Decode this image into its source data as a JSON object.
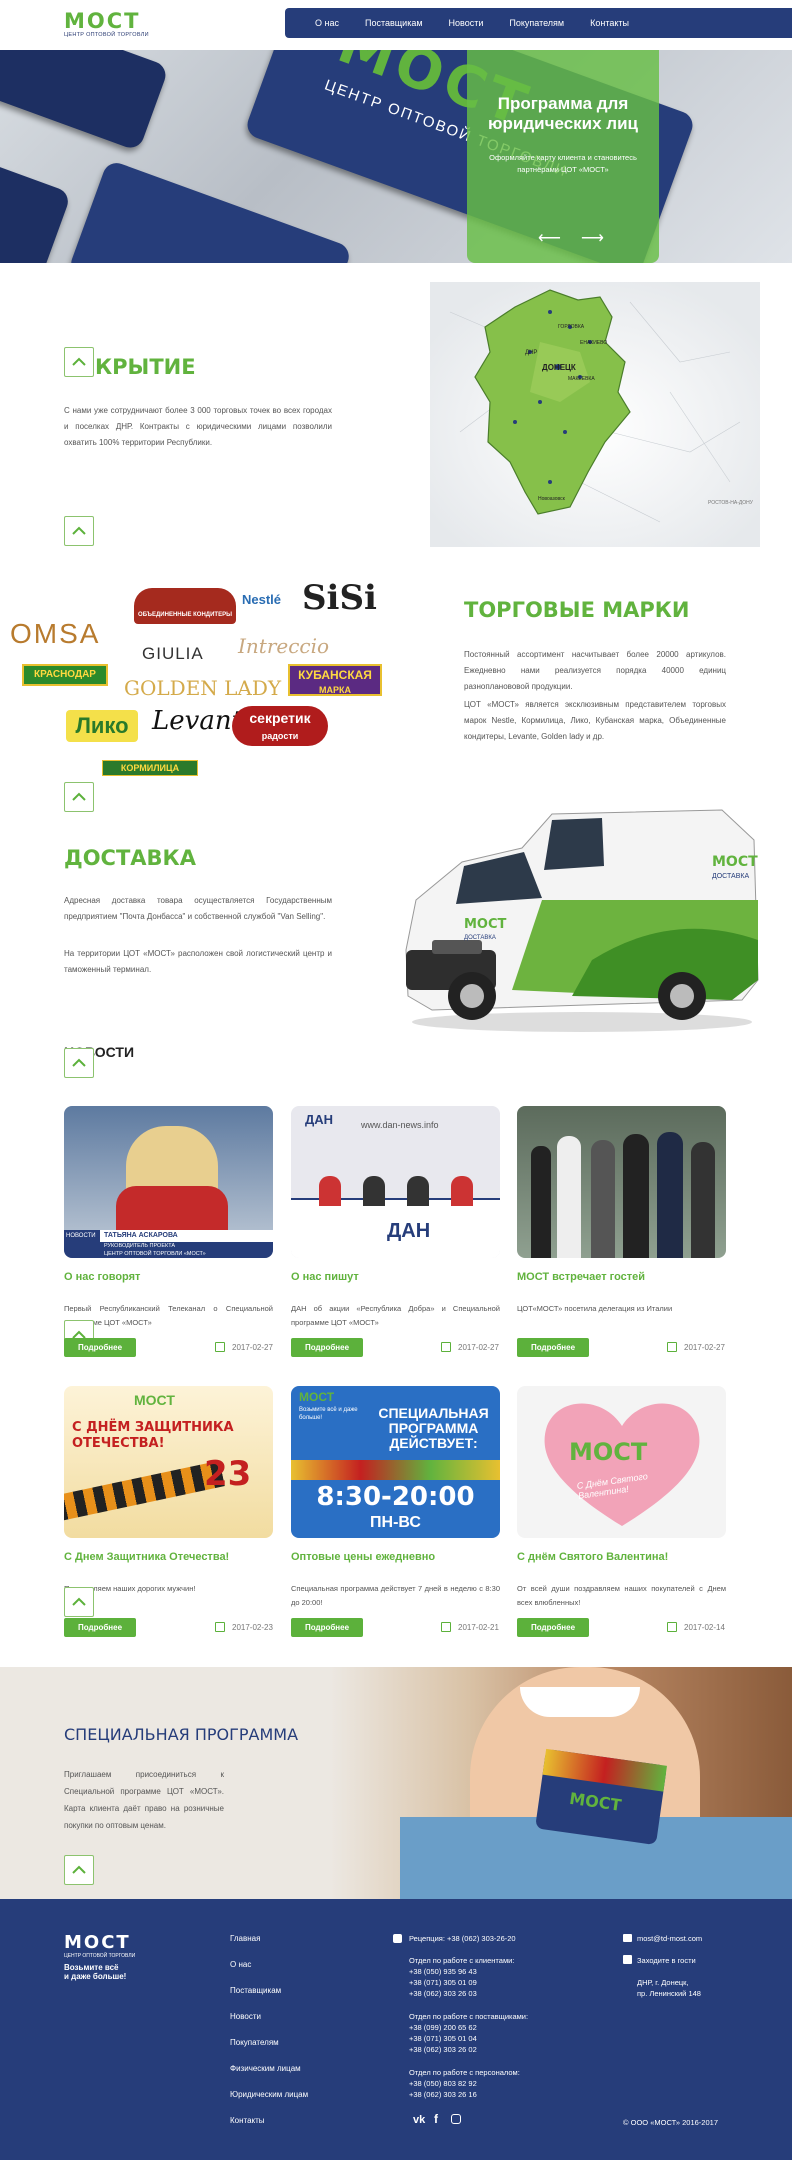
{
  "header": {
    "logo_text": "МОСТ",
    "logo_sub": "ЦЕНТР ОПТОВОЙ ТОРГОВЛИ",
    "nav": [
      "О нас",
      "Поставщикам",
      "Новости",
      "Покупателям",
      "Контакты"
    ]
  },
  "hero": {
    "card_text": "МОСТ",
    "card_sub": "ЦЕНТР ОПТОВОЙ ТОРГОВЛИ",
    "promo_title": "Программа для юридических лиц",
    "promo_text": "Оформляйте карту клиента и становитесь партнёрами ЦОТ «МОСТ»",
    "arrow_prev": "⟵",
    "arrow_next": "⟶"
  },
  "coverage": {
    "title": "КРЫТИЕ",
    "text": "С нами уже сотрудничают более 3 000 торговых точек во всех городах и поселках ДНР. Контракты с юридическими лицами позволили охватить 100% территории Республики.",
    "map_labels": [
      "ДНР",
      "ДОНЕЦК",
      "МАКЕЕВКА",
      "ГОРЛОВКА",
      "ЕНАКИЕВО",
      "Новоазовск",
      "РОСТОВ-НА-ДОНУ"
    ]
  },
  "brands": {
    "title": "ТОРГОВЫЕ МАРКИ",
    "text1": "Постоянный ассортимент насчитывает более 20000 артикулов. Ежедневно нами реализуется порядка 40000 единиц разнопланововой продукции.",
    "text2": "ЦОТ «МОСТ» является эксклюзивным представителем торговых марок Nestle, Кормилица, Лико, Кубанская марка, Объединенные кондитеры, Levante, Golden lady и др.",
    "logos": {
      "omsa": "OMSA",
      "nestle": "Nestlé",
      "sisi": "SiSi",
      "giulia": "GIULIA",
      "intrecci": "Intreccio",
      "ok": "ОБЪЕДИНЕННЫЕ КОНДИТЕРЫ",
      "krasnodar": "КРАСНОДАР",
      "goldenlady": "GOLDEN LADY",
      "kuban": "КУБАНСКАЯ",
      "kuban2": "МАРКА",
      "liko": "Лико",
      "levante": "Levante",
      "sekretik": "секретик",
      "sekretik2": "радости",
      "kormil": "КОРМИЛИЦА"
    }
  },
  "delivery": {
    "title": "ДОСТАВКА",
    "text1": "Адресная доставка товара осуществляется Государственным предприятием \"Почта Донбасса\" и собственной службой \"Van Selling\".",
    "text2": "На территории ЦОТ «МОСТ» расположен свой логистический центр и таможенный терминал.",
    "van_logo": "МОСТ",
    "van_sub": "ДОСТАВКА"
  },
  "news": {
    "title": "НОВОСТИ",
    "more": "Подробнее",
    "items": [
      {
        "title": "О нас говорят",
        "text": "Первый Республиканский Телеканал о Специальной программе ЦОТ «МОСТ»",
        "date": "2017-02-27",
        "img_caption1": "ТАТЬЯНА АСКАРОВА",
        "img_caption2": "РУКОВОДИТЕЛЬ ПРОЕКТА",
        "img_caption3": "ЦЕНТР ОПТОВОЙ ТОРГОВЛИ «МОСТ»",
        "img_tag": "НОВОСТИ"
      },
      {
        "title": "О нас пишут",
        "text": "ДАН об акции «Республика Добра» и Специальной программе ЦОТ «МОСТ»",
        "date": "2017-02-27",
        "img_caption1": "www.dan-news.info",
        "img_tag": "ДАН"
      },
      {
        "title": "МОСТ встречает гостей",
        "text": "ЦОТ«МОСТ» посетила делегация из Италии",
        "date": "2017-02-27"
      },
      {
        "title": "С Днем Защитника Отечества!",
        "text": "Поздравляем наших дорогих мужчин!",
        "date": "2017-02-23",
        "img_caption1": "С ДНЁМ ЗАЩИТНИКА",
        "img_caption2": "ОТЕЧЕСТВА!",
        "img_num": "23",
        "img_logo": "МОСТ"
      },
      {
        "title": "Оптовые цены ежедневно",
        "text": "Специальная программа действует 7 дней в неделю с 8:30 до 20:00!",
        "date": "2017-02-21",
        "img_caption1": "СПЕЦИАЛЬНАЯ",
        "img_caption2": "ПРОГРАММА",
        "img_caption3": "ДЕЙСТВУЕТ:",
        "img_time": "8:30-20:00",
        "img_days": "ПН-ВС",
        "img_logo": "МОСТ",
        "img_slogan": "Возьмите всё и даже больше!"
      },
      {
        "title": "С днём Святого Валентина!",
        "text": "От всей души поздравляем наших покупателей с Днем всех влюбленных!",
        "date": "2017-02-14",
        "img_logo": "МОСТ",
        "img_caption1": "С Днём Святого Валентина!"
      }
    ]
  },
  "special": {
    "title": "СПЕЦИАЛЬНАЯ ПРОГРАММА",
    "text": "Приглашаем присоединиться к Специальной программе ЦОТ «МОСТ». Карта клиента даёт право на розничные покупки по оптовым ценам.",
    "card_logo": "МОСТ"
  },
  "footer": {
    "logo_text": "МОСТ",
    "logo_sub": "ЦЕНТР ОПТОВОЙ ТОРГОВЛИ",
    "slogan1": "Возьмите всё",
    "slogan2": "и даже больше!",
    "links": [
      "Главная",
      "О нас",
      "Поставщикам",
      "Новости",
      "Покупателям",
      "Физическим лицам",
      "Юридическим лицам",
      "Контакты"
    ],
    "reception": "Рецепция: +38 (062) 303-26-20",
    "clients_title": "Отдел по работе с клиентами:",
    "clients": [
      "+38 (050) 935 96 43",
      "+38 (071) 305 01 09",
      "+38 (062) 303 26 03"
    ],
    "suppliers_title": "Отдел по работе с поставщиками:",
    "suppliers": [
      "+38 (099) 200 65 62",
      "+38 (071) 305 01 04",
      "+38 (062) 303 26 02"
    ],
    "staff_title": "Отдел по работе с персоналом:",
    "staff": [
      "+38 (050) 803 82 92",
      "+38 (062) 303 26 16"
    ],
    "email": "most@td-most.com",
    "visit": "Заходите в гости",
    "addr1": "ДНР, г. Донецк,",
    "addr2": "пр. Ленинский 148",
    "copyright": "© ООО «МОСТ» 2016-2017",
    "social": [
      "vk",
      "f",
      "instagram"
    ]
  },
  "colors": {
    "green": "#61b33e",
    "navy": "#263d7a",
    "button": "#5cb13b"
  }
}
